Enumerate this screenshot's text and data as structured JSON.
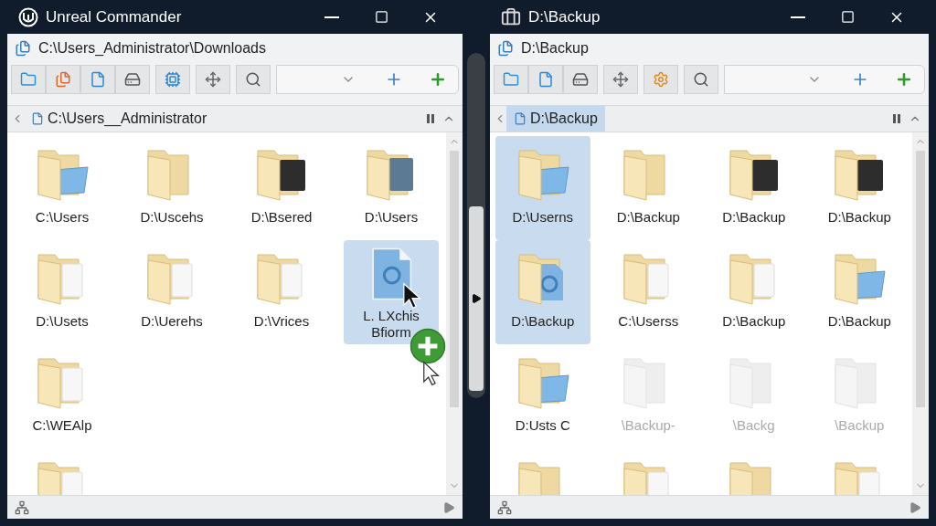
{
  "windows": [
    {
      "title": "Unreal Commander",
      "app_icon": {
        "kind": "logo"
      },
      "path": "C:\\Users_Administrator\\Downloads",
      "toolbar": [
        [
          {
            "kind": "folder"
          },
          {
            "kind": "pages"
          },
          {
            "kind": "page"
          },
          {
            "kind": "drive"
          }
        ],
        [
          {
            "kind": "chip"
          }
        ],
        [
          {
            "kind": "arrows"
          }
        ],
        [
          {
            "kind": "search"
          }
        ]
      ],
      "tab": {
        "label": "C:\\Users__Administrator",
        "selected": false
      },
      "items": [
        {
          "kind": "folder-blue",
          "label": "C:\\Users",
          "selected": false
        },
        {
          "kind": "folder-plain",
          "label": "D:\\Uscehs",
          "selected": false
        },
        {
          "kind": "folder-dark",
          "label": "D:\\Bsered",
          "selected": false
        },
        {
          "kind": "folder-photo",
          "label": "D:\\Users",
          "selected": false
        },
        {
          "kind": "folder-page",
          "label": "D:\\Usets",
          "selected": false
        },
        {
          "kind": "folder-page",
          "label": "D:\\Uerehs",
          "selected": false
        },
        {
          "kind": "folder-page",
          "label": "D:\\Vrices",
          "selected": false
        },
        {
          "kind": "document",
          "label": "L. LXchis\nBfiorm",
          "selected": true,
          "dragging": true
        },
        {
          "kind": "folder-page",
          "label": "C:\\WEAlp",
          "selected": false
        },
        {
          "kind": "spacer"
        },
        {
          "kind": "spacer"
        },
        {
          "kind": "spacer"
        },
        {
          "kind": "folder-page",
          "selected": false
        }
      ]
    },
    {
      "title": "D:\\Backup",
      "app_icon": {
        "kind": "case"
      },
      "path": "D:\\Backup",
      "toolbar": [
        [
          {
            "kind": "folder"
          },
          {
            "kind": "page"
          },
          {
            "kind": "drive"
          }
        ],
        [
          {
            "kind": "arrows"
          }
        ],
        [
          {
            "kind": "gear"
          }
        ],
        [
          {
            "kind": "search"
          }
        ]
      ],
      "tab": {
        "label": "D:\\Backup",
        "selected": true
      },
      "items": [
        {
          "kind": "folder-blue",
          "label": "D:\\Userns",
          "selected": true
        },
        {
          "kind": "folder-plain",
          "label": "D:\\Backup",
          "selected": false
        },
        {
          "kind": "folder-dark",
          "label": "D:\\Backup",
          "selected": false
        },
        {
          "kind": "folder-dark",
          "label": "D:\\Backup",
          "selected": false
        },
        {
          "kind": "folder-document",
          "label": "D:\\Backup",
          "selected": true
        },
        {
          "kind": "folder-page",
          "label": "C:\\Userss",
          "selected": false
        },
        {
          "kind": "folder-page",
          "label": "D:\\Backup",
          "selected": false
        },
        {
          "kind": "folder-blue",
          "label": "D:\\Backup",
          "selected": false
        },
        {
          "kind": "folder-blue",
          "label": "D:Usts C",
          "selected": false
        },
        {
          "kind": "ghost",
          "label": "\\Backup-",
          "selected": false
        },
        {
          "kind": "ghost",
          "label": "\\Backg",
          "selected": false
        },
        {
          "kind": "ghost",
          "label": "\\Backup",
          "selected": false
        },
        {
          "kind": "folder-plain",
          "selected": false
        },
        {
          "kind": "folder-page",
          "selected": false
        },
        {
          "kind": "folder-plain",
          "selected": false
        },
        {
          "kind": "folder-page",
          "selected": false
        }
      ]
    }
  ]
}
